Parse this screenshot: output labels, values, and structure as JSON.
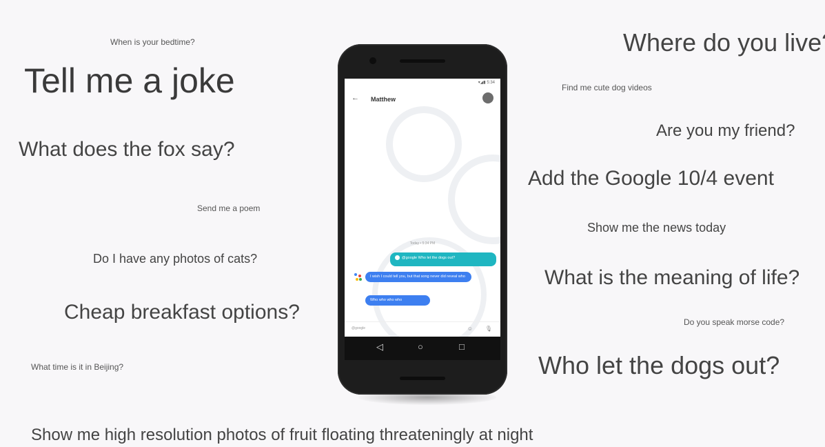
{
  "phrases": {
    "bedtime": "When is your bedtime?",
    "joke": "Tell me a joke",
    "fox": "What does the fox say?",
    "poem": "Send me a poem",
    "cats": "Do I have any photos of cats?",
    "breakfast": "Cheap breakfast options?",
    "beijing": "What time is it in Beijing?",
    "fruit": "Show me high resolution photos of fruit floating threateningly at night",
    "live": "Where do you live?",
    "dogvideos": "Find me cute dog videos",
    "friend": "Are you my friend?",
    "event": "Add the Google 10/4 event",
    "news": "Show me the news today",
    "meaning": "What is the meaning of life?",
    "morse": "Do you speak morse code?",
    "dogs": "Who let the dogs out?"
  },
  "phone": {
    "status_time": "▾◢▮ 5:34",
    "contact_name": "Matthew",
    "timestamp": "Today • 5:34 PM",
    "user_message": "@google Who let the dogs out?",
    "assistant_reply_1": "I wish I could tell you, but that song never did reveal who",
    "assistant_reply_2": "Who who who who",
    "input_placeholder": "@google",
    "icons": {
      "back": "back-arrow-icon",
      "emoji": "emoji-icon",
      "mic": "mic-icon",
      "nav_back": "nav-back-icon",
      "nav_home": "nav-home-icon",
      "nav_recents": "nav-recents-icon"
    },
    "colors": {
      "user_bubble": "#1fb6c1",
      "assistant_bubble": "#3d7ff0",
      "phone_body": "#1d1d1d"
    }
  }
}
